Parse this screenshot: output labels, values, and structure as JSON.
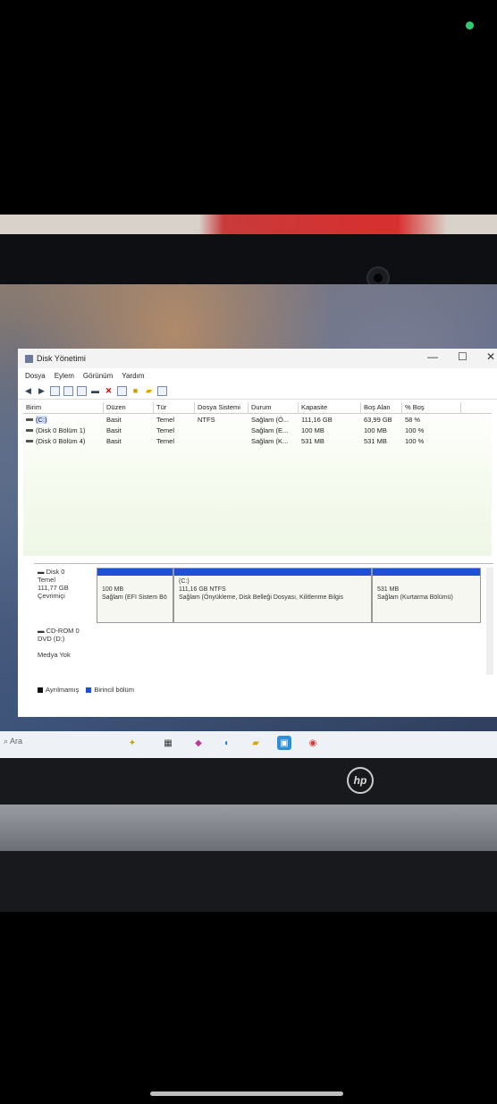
{
  "window": {
    "title": "Disk Yönetimi",
    "minimize": "—",
    "maximize": "☐",
    "close": "✕"
  },
  "menu": [
    "Dosya",
    "Eylem",
    "Görünüm",
    "Yardım"
  ],
  "volumes": {
    "columns": [
      "Birim",
      "Düzen",
      "Tür",
      "Dosya Sistemi",
      "Durum",
      "Kapasite",
      "Boş Alan",
      "% Boş"
    ],
    "rows": [
      [
        "(C:)",
        "Basit",
        "Temel",
        "NTFS",
        "Sağlam (Ö...",
        "111,16 GB",
        "63,99 GB",
        "58 %"
      ],
      [
        "(Disk 0 Bölüm 1)",
        "Basit",
        "Temel",
        "",
        "Sağlam (E...",
        "100 MB",
        "100 MB",
        "100 %"
      ],
      [
        "(Disk 0 Bölüm 4)",
        "Basit",
        "Temel",
        "",
        "Sağlam (K...",
        "531 MB",
        "531 MB",
        "100 %"
      ]
    ]
  },
  "disk0": {
    "name": "Disk 0",
    "type": "Temel",
    "size": "111,77 GB",
    "status": "Çevrimiçi",
    "partitions": [
      {
        "line1": "100 MB",
        "line2": "Sağlam (EFI Sistem Bö"
      },
      {
        "line0": "(C:)",
        "line1": "111,16 GB NTFS",
        "line2": "Sağlam (Önyükleme, Disk Belleği Dosyası, Kilitlenme Bilgis"
      },
      {
        "line1": "531 MB",
        "line2": "Sağlam (Kurtarma Bölümü)"
      }
    ]
  },
  "cdrom": {
    "name": "CD-ROM 0",
    "drive": "DVD (D:)",
    "status": "Medya Yok"
  },
  "legend": [
    {
      "label": "Ayrılmamış",
      "color": "#111111"
    },
    {
      "label": "Birincil bölüm",
      "color": "#1f4fd6"
    }
  ],
  "taskbar": {
    "search": "Ara"
  },
  "brand": "hp",
  "colors": {
    "partition_stripe": "#1f4fd6",
    "status_dot": "#2ecc71"
  }
}
